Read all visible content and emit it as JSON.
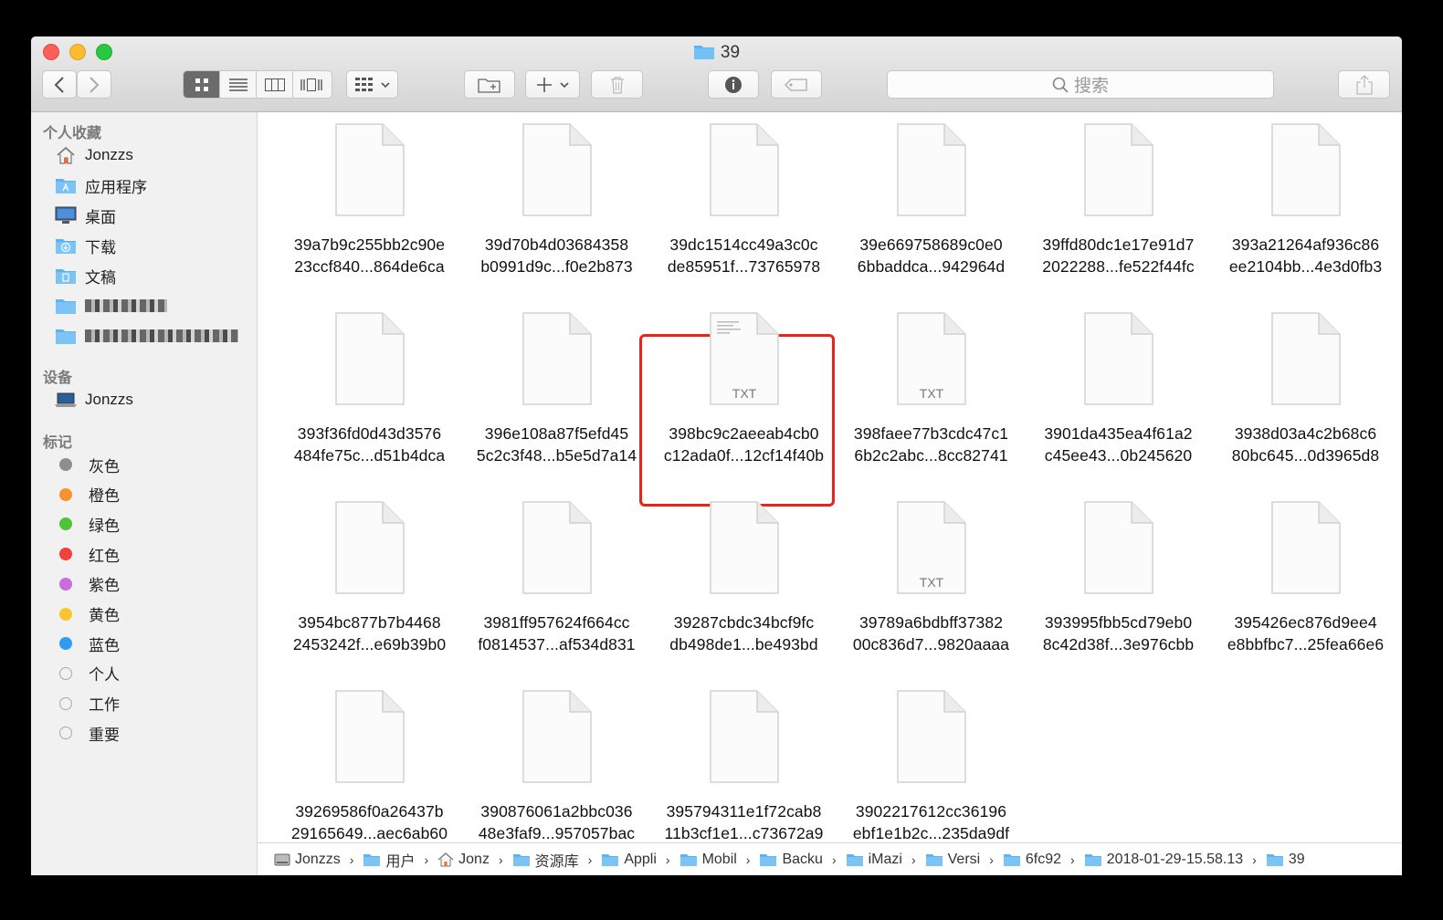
{
  "window": {
    "title": "39"
  },
  "toolbar": {
    "back_icon": "chevron-left-icon",
    "forward_icon": "chevron-right-icon",
    "view_modes": [
      "icon-view-icon",
      "list-view-icon",
      "column-view-icon",
      "gallery-view-icon"
    ],
    "active_view": "icon-view-icon",
    "search_placeholder": "搜索"
  },
  "sidebar": {
    "favorites_header": "个人收藏",
    "favorites": [
      {
        "label": "Jonzzs",
        "icon": "home-icon"
      },
      {
        "label": "应用程序",
        "icon": "applications-icon"
      },
      {
        "label": "桌面",
        "icon": "desktop-icon"
      },
      {
        "label": "下载",
        "icon": "downloads-icon"
      },
      {
        "label": "文稿",
        "icon": "documents-icon"
      }
    ],
    "devices_header": "设备",
    "devices": [
      {
        "label": "Jonzzs",
        "icon": "laptop-icon"
      }
    ],
    "tags_header": "标记",
    "tags": [
      {
        "label": "灰色",
        "color": "#8e8e8e"
      },
      {
        "label": "橙色",
        "color": "#f7932f"
      },
      {
        "label": "绿色",
        "color": "#4fc43a"
      },
      {
        "label": "红色",
        "color": "#f2403a"
      },
      {
        "label": "紫色",
        "color": "#c86ddb"
      },
      {
        "label": "黄色",
        "color": "#fbc52e"
      },
      {
        "label": "蓝色",
        "color": "#2f9bf5"
      },
      {
        "label": "个人",
        "color": ""
      },
      {
        "label": "工作",
        "color": ""
      },
      {
        "label": "重要",
        "color": ""
      }
    ]
  },
  "files": [
    {
      "line1": "39a7b9c255bb2c90e",
      "line2": "23ccf840...864de6ca",
      "badge": ""
    },
    {
      "line1": "39d70b4d03684358",
      "line2": "b0991d9c...f0e2b873",
      "badge": ""
    },
    {
      "line1": "39dc1514cc49a3c0c",
      "line2": "de85951f...73765978",
      "badge": ""
    },
    {
      "line1": "39e669758689c0e0",
      "line2": "6bbaddca...942964d",
      "badge": ""
    },
    {
      "line1": "39ffd80dc1e17e91d7",
      "line2": "2022288...fe522f44fc",
      "badge": ""
    },
    {
      "line1": "393a21264af936c86",
      "line2": "ee2104bb...4e3d0fb3",
      "badge": ""
    },
    {
      "line1": "393f36fd0d43d3576",
      "line2": "484fe75c...d51b4dca",
      "badge": ""
    },
    {
      "line1": "396e108a87f5efd45",
      "line2": "5c2c3f48...b5e5d7a14",
      "badge": ""
    },
    {
      "line1": "398bc9c2aeeab4cb0",
      "line2": "c12ada0f...12cf14f40b",
      "badge": "TXT",
      "selected": true
    },
    {
      "line1": "398faee77b3cdc47c1",
      "line2": "6b2c2abc...8cc82741",
      "badge": "TXT"
    },
    {
      "line1": "3901da435ea4f61a2",
      "line2": "c45ee43...0b245620",
      "badge": ""
    },
    {
      "line1": "3938d03a4c2b68c6",
      "line2": "80bc645...0d3965d8",
      "badge": ""
    },
    {
      "line1": "3954bc877b7b4468",
      "line2": "2453242f...e69b39b0",
      "badge": ""
    },
    {
      "line1": "3981ff957624f664cc",
      "line2": "f0814537...af534d831",
      "badge": ""
    },
    {
      "line1": "39287cbdc34bcf9fc",
      "line2": "db498de1...be493bd",
      "badge": ""
    },
    {
      "line1": "39789a6bdbff37382",
      "line2": "00c836d7...9820aaaa",
      "badge": "TXT"
    },
    {
      "line1": "393995fbb5cd79eb0",
      "line2": "8c42d38f...3e976cbb",
      "badge": ""
    },
    {
      "line1": "395426ec876d9ee4",
      "line2": "e8bbfbc7...25fea66e6",
      "badge": ""
    },
    {
      "line1": "39269586f0a26437b",
      "line2": "29165649...aec6ab60",
      "badge": ""
    },
    {
      "line1": "390876061a2bbc036",
      "line2": "48e3faf9...957057bac",
      "badge": ""
    },
    {
      "line1": "395794311e1f72cab8",
      "line2": "11b3cf1e1...c73672a9",
      "badge": ""
    },
    {
      "line1": "3902217612cc36196",
      "line2": "ebf1e1b2c...235da9df",
      "badge": ""
    }
  ],
  "path": [
    {
      "label": "Jonzzs",
      "icon": "disk-icon"
    },
    {
      "label": "用户",
      "icon": "folder-icon"
    },
    {
      "label": "Jonz",
      "icon": "home-icon"
    },
    {
      "label": "资源库",
      "icon": "folder-icon"
    },
    {
      "label": "Appli",
      "icon": "folder-icon"
    },
    {
      "label": "Mobil",
      "icon": "folder-icon"
    },
    {
      "label": "Backu",
      "icon": "folder-icon"
    },
    {
      "label": "iMazi",
      "icon": "folder-icon"
    },
    {
      "label": "Versi",
      "icon": "folder-icon"
    },
    {
      "label": "6fc92",
      "icon": "folder-icon"
    },
    {
      "label": "2018-01-29-15.58.13",
      "icon": "folder-icon"
    },
    {
      "label": "39",
      "icon": "folder-icon"
    }
  ],
  "colors": {
    "selection": "#e8231a",
    "folder_blue": "#5bb3ef"
  }
}
